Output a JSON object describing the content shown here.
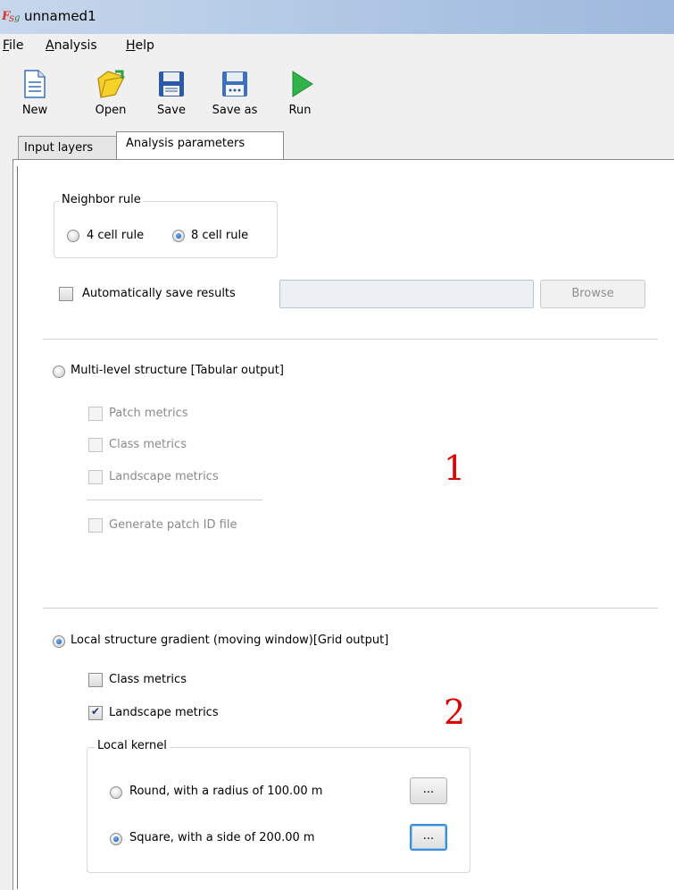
{
  "window": {
    "title": "unnamed1"
  },
  "menu": {
    "file": "File",
    "analysis": "Analysis",
    "help": "Help"
  },
  "toolbar": {
    "new": "New",
    "open": "Open",
    "save": "Save",
    "save_as": "Save as",
    "run": "Run"
  },
  "tabs": {
    "input_layers": "Input layers",
    "analysis_parameters": "Analysis parameters"
  },
  "neighbor_rule": {
    "legend": "Neighbor rule",
    "four": "4 cell rule",
    "eight": "8 cell rule",
    "selected": "8 cell rule"
  },
  "auto_save": {
    "label": "Automatically save results",
    "checked": false,
    "path_value": "",
    "browse": "Browse"
  },
  "multi_level": {
    "label": "Multi-level structure [Tabular output]",
    "selected": false,
    "patch": "Patch metrics",
    "class": "Class metrics",
    "landscape": "Landscape metrics",
    "patch_id": "Generate patch ID file"
  },
  "local_gradient": {
    "label": "Local structure gradient (moving window)[Grid output]",
    "selected": true,
    "class": "Class metrics",
    "class_checked": false,
    "landscape": "Landscape metrics",
    "landscape_checked": true,
    "kernel": {
      "legend": "Local kernel",
      "round": "Round, with a radius of 100.00 m",
      "square": "Square, with a side of 200.00 m",
      "selected": "Square, with a side of 200.00 m",
      "ellipsis": "..."
    }
  },
  "annotations": {
    "one": "1",
    "two": "2"
  },
  "colors": {
    "annotation": "#e00000",
    "run_icon": "#2fb34a",
    "title_bar": "#b5cbe6"
  }
}
